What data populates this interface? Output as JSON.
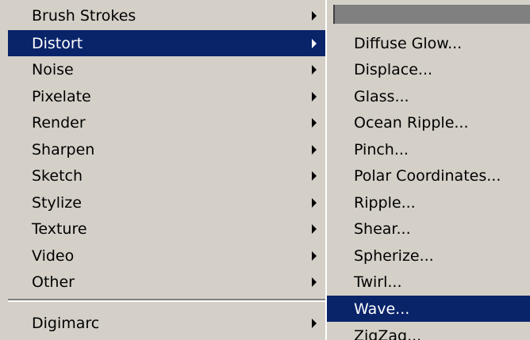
{
  "main_menu": {
    "items": [
      {
        "label": "Brush Strokes"
      },
      {
        "label": "Distort"
      },
      {
        "label": "Noise"
      },
      {
        "label": "Pixelate"
      },
      {
        "label": "Render"
      },
      {
        "label": "Sharpen"
      },
      {
        "label": "Sketch"
      },
      {
        "label": "Stylize"
      },
      {
        "label": "Texture"
      },
      {
        "label": "Video"
      },
      {
        "label": "Other"
      },
      {
        "label": "Digimarc"
      }
    ],
    "selected": "Distort"
  },
  "distort_submenu": {
    "items": [
      {
        "label": "Diffuse Glow..."
      },
      {
        "label": "Displace..."
      },
      {
        "label": "Glass..."
      },
      {
        "label": "Ocean Ripple..."
      },
      {
        "label": "Pinch..."
      },
      {
        "label": "Polar Coordinates..."
      },
      {
        "label": "Ripple..."
      },
      {
        "label": "Shear..."
      },
      {
        "label": "Spherize..."
      },
      {
        "label": "Twirl..."
      },
      {
        "label": "Wave..."
      },
      {
        "label": "ZigZag..."
      }
    ],
    "selected": "Wave..."
  },
  "colors": {
    "menu_bg": "#d4d0c8",
    "highlight": "#0a246a",
    "highlight_text": "#ffffff"
  }
}
